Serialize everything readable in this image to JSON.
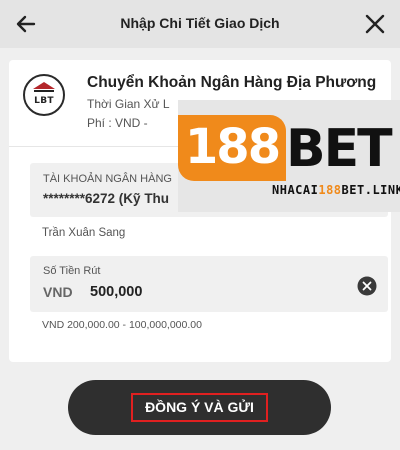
{
  "header": {
    "title": "Nhập Chi Tiết Giao Dịch",
    "back_icon": "arrow-left-icon",
    "close_icon": "close-icon"
  },
  "bank": {
    "logo_text": "LBT",
    "logo_icon": "bank-building-icon",
    "name": "Chuyển Khoản Ngân Hàng Địa Phương",
    "process_time": "Thời Gian Xử L",
    "fee": "Phí : VND -"
  },
  "account": {
    "label": "TÀI KHOẢN NGÂN HÀNG",
    "value": "********6272 (Kỹ Thu",
    "holder": "Trần Xuân Sang"
  },
  "amount": {
    "label": "Số Tiền Rút",
    "currency": "VND",
    "value": "500,000",
    "range": "VND 200,000.00 - 100,000,000.00",
    "clear_icon": "clear-circle-icon"
  },
  "watermark": {
    "brand_number": "188",
    "brand_word": "BET",
    "link_prefix": "NHACAI",
    "link_highlight": "188",
    "link_suffix": "BET.LINK"
  },
  "submit": {
    "label": "ĐỒNG Ý VÀ GỬI"
  },
  "colors": {
    "header_bg": "#e4e4e4",
    "page_bg": "#efefef",
    "field_bg": "#f0f0f0",
    "button_bg": "#2f2f2f",
    "highlight_border": "#e02020",
    "watermark_orange": "#f08a1b"
  }
}
